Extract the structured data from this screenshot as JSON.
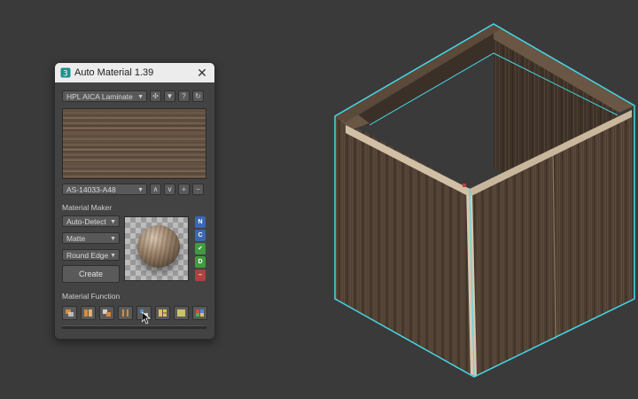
{
  "panel": {
    "title": "Auto Material 1.39",
    "close_glyph": "✕",
    "library_dropdown": {
      "value": "HPL AICA Laminate"
    },
    "material_dropdown": {
      "value": "AS-14033-A48"
    },
    "top_icons": [
      "crosshair-icon",
      "filter-icon",
      "help-icon",
      "refresh-icon"
    ],
    "nav_buttons": [
      {
        "name": "prev-material-button",
        "glyph": "∧"
      },
      {
        "name": "next-material-button",
        "glyph": "∨"
      },
      {
        "name": "add-material-button",
        "glyph": "+"
      },
      {
        "name": "remove-material-button",
        "glyph": "−"
      }
    ],
    "maker": {
      "section_label": "Material Maker",
      "detect_mode": "Auto-Detect",
      "finish": "Matte",
      "edge": "Round Edge",
      "create_label": "Create",
      "side_buttons": [
        {
          "label": "N",
          "color": "#3b67b5"
        },
        {
          "label": "C",
          "color": "#3b67b5"
        },
        {
          "label": "✔",
          "color": "#3f9b3f"
        },
        {
          "label": "D",
          "color": "#3f9b3f"
        },
        {
          "label": "–",
          "color": "#b04141"
        }
      ]
    },
    "function": {
      "section_label": "Material Function",
      "buttons": [
        "apply-icon",
        "split-icon",
        "align-icon",
        "flip-icon",
        "random-icon",
        "layout-icon",
        "fill-icon",
        "palette-icon"
      ]
    }
  },
  "colors": {
    "viewport_bg": "#3a3a3a",
    "selection_outline": "#45d8e8",
    "wood_dark": "#4c3d31",
    "panel_bg": "#434343"
  }
}
